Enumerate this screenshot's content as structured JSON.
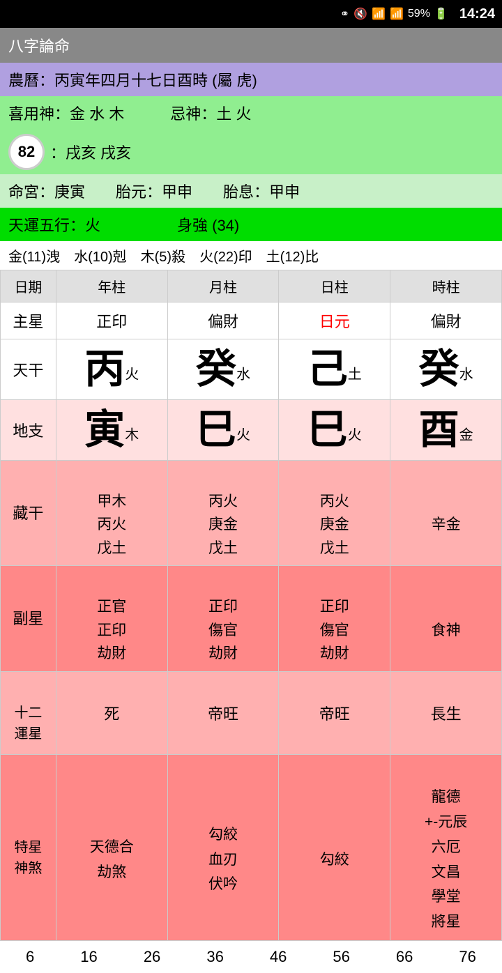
{
  "statusBar": {
    "battery": "59%",
    "time": "14:24"
  },
  "titleBar": {
    "title": "八字論命"
  },
  "rows": {
    "lunarCalendar": "農曆：丙寅年四月十七日酉時 (屬 虎)",
    "xiyong": "喜用神：金 水 木　　　忌神：土 火",
    "badge": "82",
    "xingchen": "：戌亥 戌亥",
    "minggong": "命宮：庚寅　　胎元：甲申　　胎息：甲申",
    "tianyun": "天運五行：火　　　　　身強 (34)",
    "wuxing": "金(11)洩　水(10)剋　木(5)殺　火(22)印　土(12)比"
  },
  "tableHeader": {
    "col0": "日期",
    "col1": "年柱",
    "col2": "月柱",
    "col3": "日柱",
    "col4": "時柱"
  },
  "zhuxing": {
    "label": "主星",
    "col1": "正印",
    "col2": "偏財",
    "col3": "日元",
    "col4": "偏財"
  },
  "tiangan": {
    "label": "天干",
    "col1_big": "丙",
    "col1_sub": "火",
    "col2_big": "癸",
    "col2_sub": "水",
    "col3_big": "己",
    "col3_sub": "土",
    "col4_big": "癸",
    "col4_sub": "水"
  },
  "dizhi": {
    "label": "地支",
    "col1_big": "寅",
    "col1_sub": "木",
    "col2_big": "巳",
    "col2_sub": "火",
    "col3_big": "巳",
    "col3_sub": "火",
    "col4_big": "酉",
    "col4_sub": "金"
  },
  "zanggan": {
    "label": "藏干",
    "col1": "甲木\n丙火\n戊土",
    "col2": "丙火\n庚金\n戊土",
    "col3": "丙火\n庚金\n戊土",
    "col4": "辛金"
  },
  "fuxing": {
    "label": "副星",
    "col1": "正官\n正印\n劫財",
    "col2": "正印\n傷官\n劫財",
    "col3": "正印\n傷官\n劫財",
    "col4": "食神"
  },
  "yunxing": {
    "label": "十二\n運星",
    "col1": "死",
    "col2": "帝旺",
    "col3": "帝旺",
    "col4": "長生"
  },
  "texing": {
    "label": "特星\n神煞",
    "col1": "天德合\n劫煞",
    "col2": "勾絞\n血刃\n伏吟",
    "col3": "勾絞",
    "col4": "龍德\n+-元辰\n六厄\n文昌\n學堂\n將星"
  },
  "bottomNumbers": [
    "6",
    "16",
    "26",
    "36",
    "46",
    "56",
    "66",
    "76"
  ]
}
